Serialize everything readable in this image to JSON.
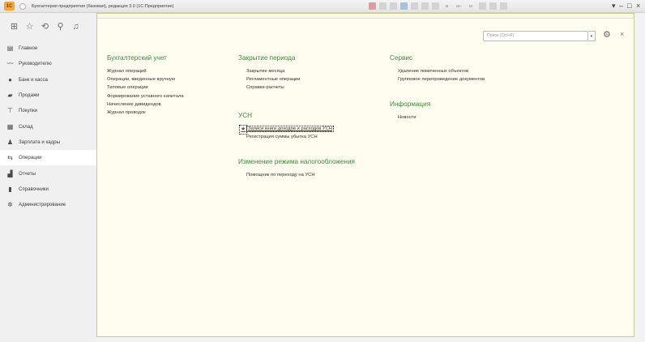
{
  "window": {
    "logo": "1С",
    "title": "Бухгалтерия предприятия (базовая), редакция 3.0 (1С:Предприятие)",
    "title_tools": [
      "M",
      "M+",
      "M-"
    ],
    "controls": {
      "dropdown": "▾",
      "minimize": "–",
      "restore": "□",
      "close": "×"
    }
  },
  "toolbar": {
    "icons": [
      "apps-grid-icon",
      "star-icon",
      "history-icon",
      "search-icon",
      "bell-icon"
    ]
  },
  "sidebar": {
    "items": [
      {
        "label": "Главное",
        "icon": "list-icon",
        "glyph": "▤"
      },
      {
        "label": "Руководителю",
        "icon": "chart-line-icon",
        "glyph": "〰"
      },
      {
        "label": "Банк и касса",
        "icon": "coin-icon",
        "glyph": "●"
      },
      {
        "label": "Продажи",
        "icon": "bag-icon",
        "glyph": "▰"
      },
      {
        "label": "Покупки",
        "icon": "cart-icon",
        "glyph": "⊤"
      },
      {
        "label": "Склад",
        "icon": "warehouse-icon",
        "glyph": "▦"
      },
      {
        "label": "Зарплата и кадры",
        "icon": "person-icon",
        "glyph": "♟"
      },
      {
        "label": "Операции",
        "icon": "operations-icon",
        "glyph": "⇆"
      },
      {
        "label": "Отчеты",
        "icon": "bar-chart-icon",
        "glyph": "▟"
      },
      {
        "label": "Справочники",
        "icon": "book-icon",
        "glyph": "▮"
      },
      {
        "label": "Администрирование",
        "icon": "gear-icon",
        "glyph": "✲"
      }
    ],
    "active": "Операции"
  },
  "search": {
    "placeholder": "Поиск (Ctrl+F)",
    "dropdown": "▾"
  },
  "panel_tools": {
    "settings": "⚙",
    "close": "×"
  },
  "sections": {
    "accounting": {
      "title": "Бухгалтерский учет",
      "links": [
        "Журнал операций",
        "Операции, введенные вручную",
        "Типовые операции",
        "Формирование уставного капитала",
        "Начисление дивидендов",
        "Журнал проводок"
      ]
    },
    "period_close": {
      "title": "Закрытие периода",
      "links": [
        "Закрытие месяца",
        "Регламентные операции",
        "Справки-расчеты"
      ]
    },
    "usn": {
      "title": "УСН",
      "links": [
        "Записи книги доходов и расходов УСН",
        "Регистрация суммы убытка УСН"
      ],
      "starred": "Записи книги доходов и расходов УСН"
    },
    "tax_mode": {
      "title": "Изменение режима налогообложения",
      "links": [
        "Помощник по переходу на УСН"
      ]
    },
    "service": {
      "title": "Сервис",
      "links": [
        "Удаление помеченных объектов",
        "Групповое перепроведение документов"
      ]
    },
    "info": {
      "title": "Информация",
      "links": [
        "Новости"
      ]
    }
  },
  "colors": {
    "accent_green": "#3c8c3c",
    "panel_bg": "#fefdf0",
    "sidebar_bg": "#f0f0f0"
  }
}
